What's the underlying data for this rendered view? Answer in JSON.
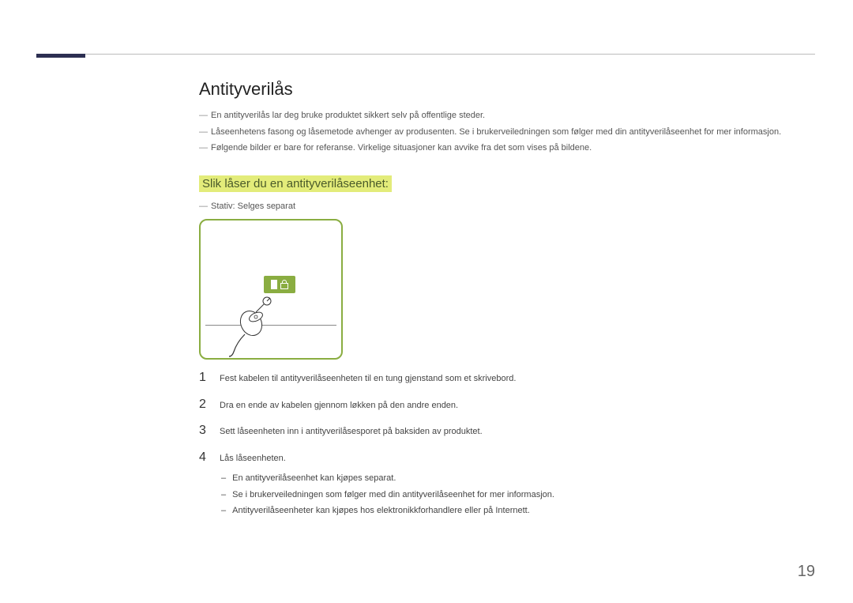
{
  "heading": "Antityverilås",
  "intro_notes": [
    "En antityverilås lar deg bruke produktet sikkert selv på offentlige steder.",
    "Låseenhetens fasong og låsemetode avhenger av produsenten. Se i brukerveiledningen som følger med din antityverilåseenhet for mer informasjon.",
    "Følgende bilder er bare for referanse. Virkelige situasjoner kan avvike fra det som vises på bildene."
  ],
  "subheading": "Slik låser du en antityverilåseenhet:",
  "sub_note": "Stativ: Selges separat",
  "steps": [
    {
      "num": "1",
      "text": "Fest kabelen til antityverilåseenheten til en tung gjenstand som et skrivebord."
    },
    {
      "num": "2",
      "text": "Dra en ende av kabelen gjennom løkken på den andre enden."
    },
    {
      "num": "3",
      "text": "Sett låseenheten inn i antityverilåsesporet på baksiden av produktet."
    },
    {
      "num": "4",
      "text": "Lås låseenheten.",
      "subs": [
        "En antityverilåseenhet kan kjøpes separat.",
        "Se i brukerveiledningen som følger med din antityverilåseenhet for mer informasjon.",
        "Antityverilåseenheter kan kjøpes hos elektronikkforhandlere eller på Internett."
      ]
    }
  ],
  "page_number": "19"
}
